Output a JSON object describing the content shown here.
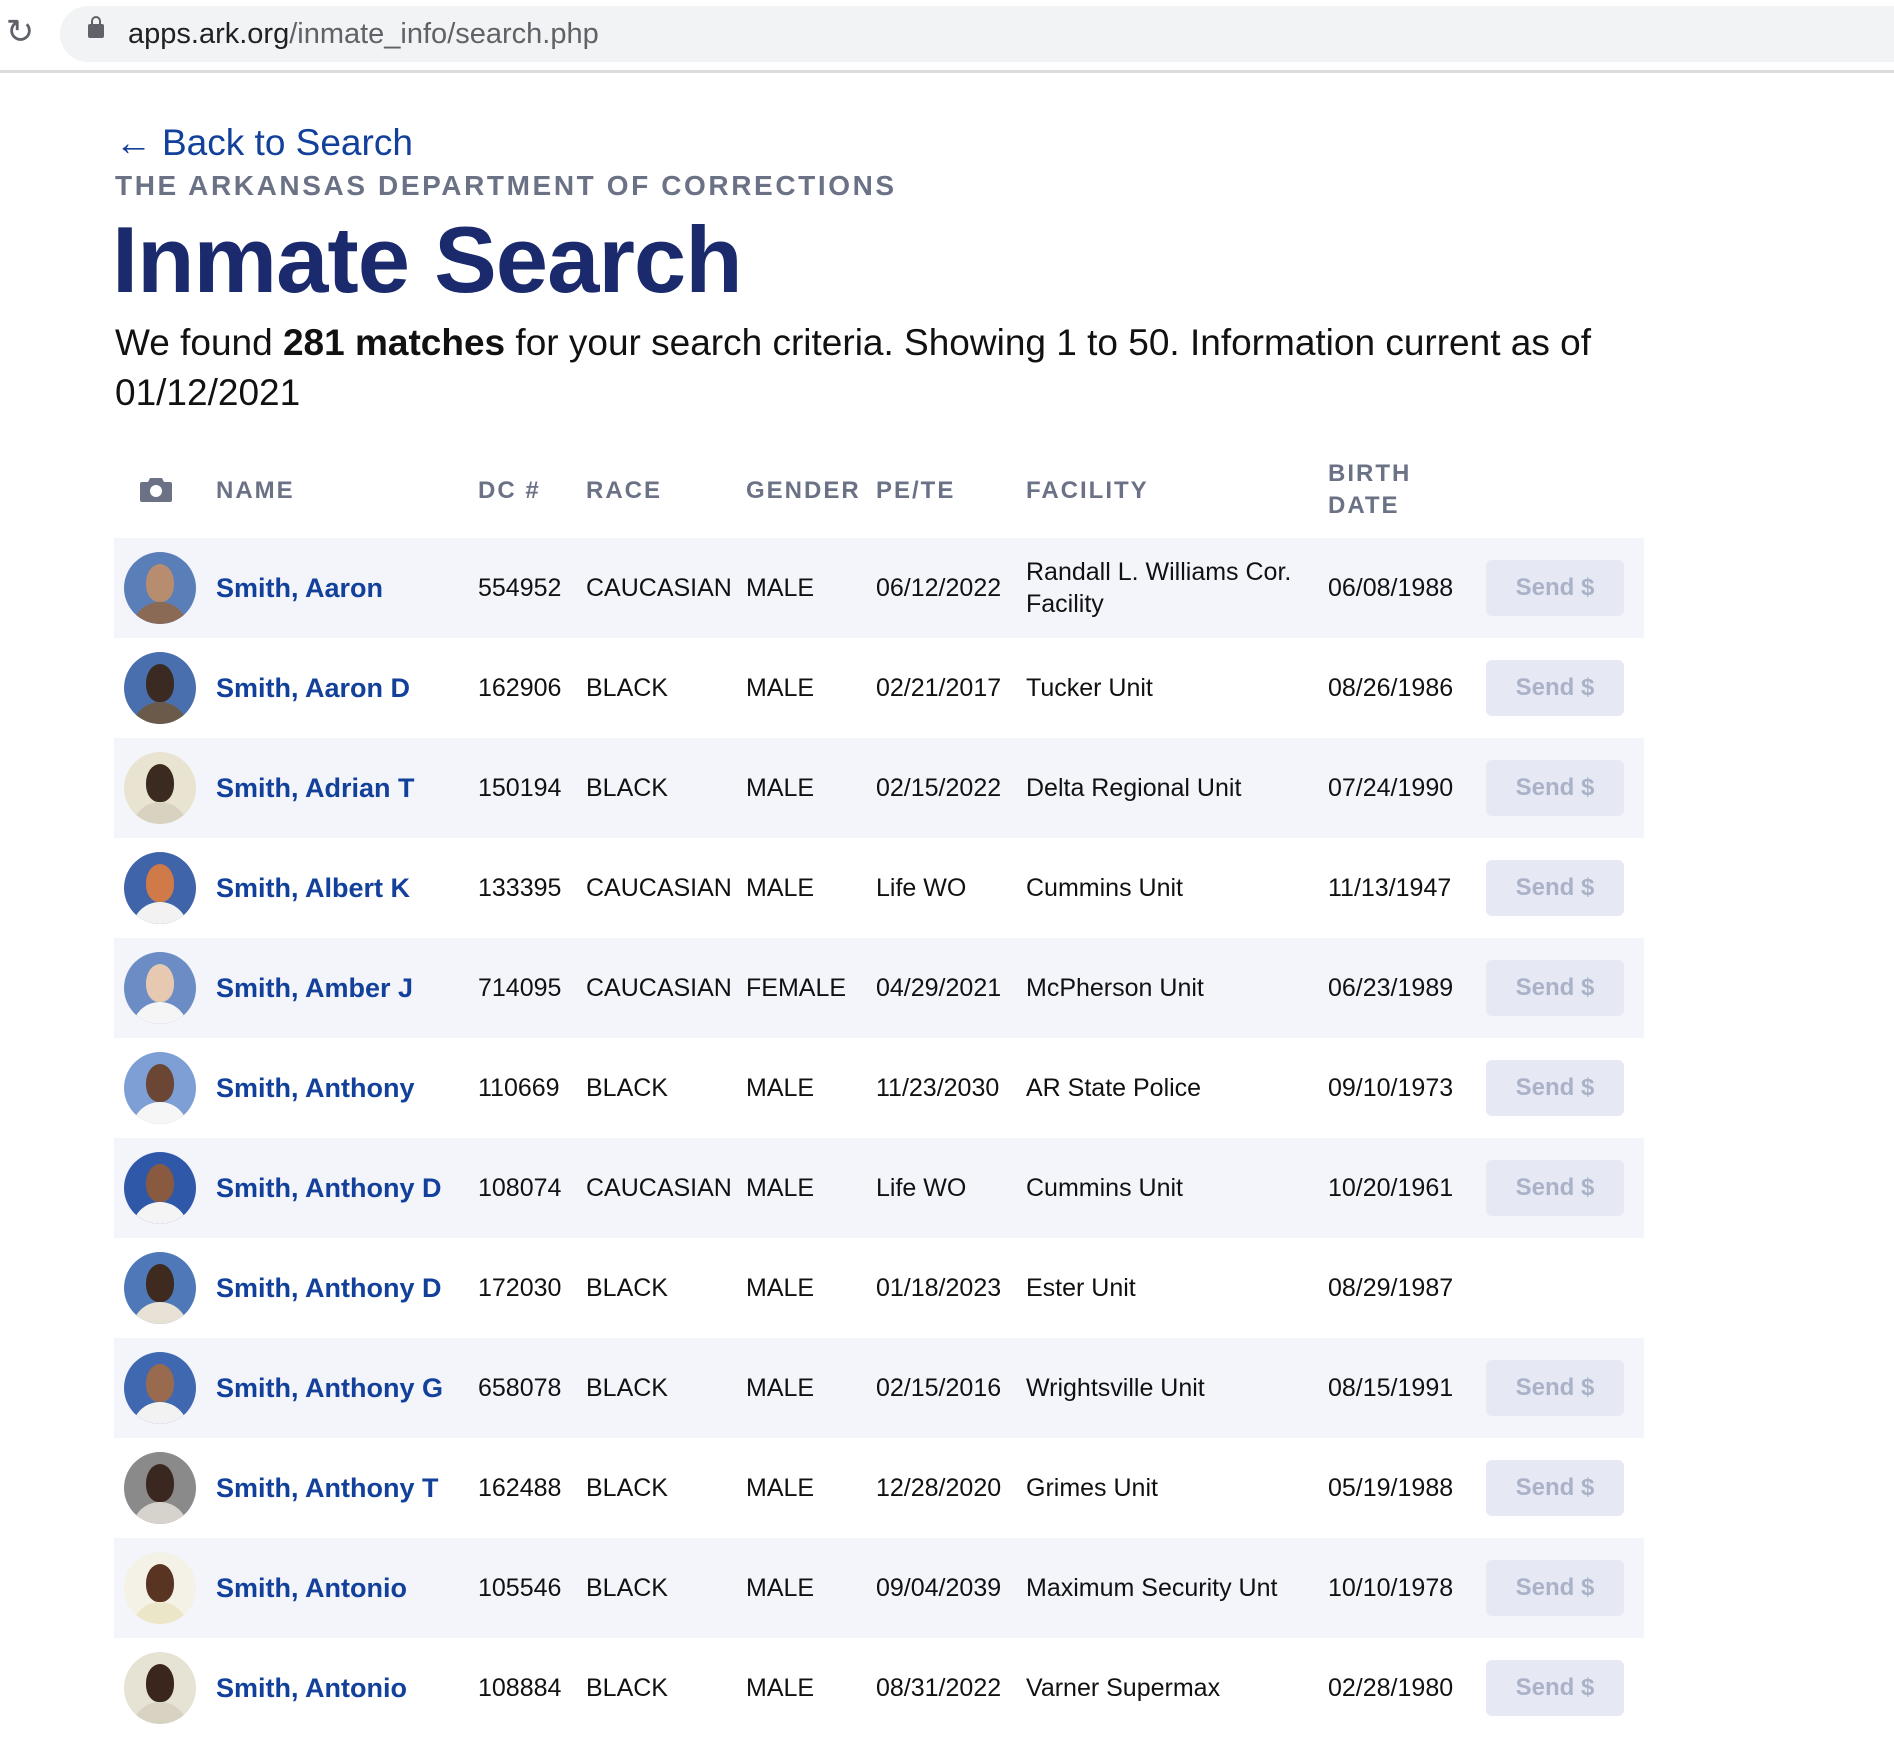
{
  "browser": {
    "url_host": "apps.ark.org",
    "url_path": "/inmate_info/search.php",
    "reload_icon": "reload-icon",
    "lock_icon": "lock-icon"
  },
  "page": {
    "back_link": "Back to Search",
    "back_arrow": "←",
    "eyebrow": "THE ARKANSAS DEPARTMENT OF CORRECTIONS",
    "title": "Inmate Search",
    "summary_prefix": "We found ",
    "summary_count": "281 matches",
    "summary_suffix": " for your search criteria. Showing 1 to 50. Information current as of 01/12/2021"
  },
  "colors": {
    "brand_navy": "#1a2a6c",
    "link_blue": "#12409a",
    "muted_gray": "#6b7286",
    "row_stripe": "#f3f5fb",
    "send_bg": "#e6e9f4",
    "send_text": "#aab2c8"
  },
  "table": {
    "headers": {
      "photo_icon": "camera-icon",
      "name": "NAME",
      "dc": "DC #",
      "race": "RACE",
      "gender": "GENDER",
      "pete": "PE/TE",
      "facility": "FACILITY",
      "birth_line1": "BIRTH",
      "birth_line2": "DATE"
    },
    "send_label": "Send $",
    "rows": [
      {
        "name": "Smith, Aaron",
        "dc": "554952",
        "race": "CAUCASIAN",
        "gender": "MALE",
        "pete": "06/12/2022",
        "facility": "Randall L. Williams Cor. Facility",
        "birth": "06/08/1988",
        "send": true,
        "skin": "#b88c6e",
        "bg": "#5a7fb8",
        "shirt": "#8a6a55"
      },
      {
        "name": "Smith, Aaron D",
        "dc": "162906",
        "race": "BLACK",
        "gender": "MALE",
        "pete": "02/21/2017",
        "facility": "Tucker Unit",
        "birth": "08/26/1986",
        "send": true,
        "skin": "#3a2a22",
        "bg": "#4a6fae",
        "shirt": "#6b5a4a"
      },
      {
        "name": "Smith, Adrian T",
        "dc": "150194",
        "race": "BLACK",
        "gender": "MALE",
        "pete": "02/15/2022",
        "facility": "Delta Regional Unit",
        "birth": "07/24/1990",
        "send": true,
        "skin": "#3b2a20",
        "bg": "#e9e4d2",
        "shirt": "#d8d2c0"
      },
      {
        "name": "Smith, Albert K",
        "dc": "133395",
        "race": "CAUCASIAN",
        "gender": "MALE",
        "pete": "Life WO",
        "facility": "Cummins Unit",
        "birth": "11/13/1947",
        "send": true,
        "skin": "#d07a4a",
        "bg": "#3f64a8",
        "shirt": "#f2f2f2"
      },
      {
        "name": "Smith, Amber J",
        "dc": "714095",
        "race": "CAUCASIAN",
        "gender": "FEMALE",
        "pete": "04/29/2021",
        "facility": "McPherson Unit",
        "birth": "06/23/1989",
        "send": true,
        "skin": "#e6c9b0",
        "bg": "#6b8cc4",
        "shirt": "#f5f5f5"
      },
      {
        "name": "Smith, Anthony",
        "dc": "110669",
        "race": "BLACK",
        "gender": "MALE",
        "pete": "11/23/2030",
        "facility": "AR State Police",
        "birth": "09/10/1973",
        "send": true,
        "skin": "#6b4634",
        "bg": "#7d9fd6",
        "shirt": "#f6f6f6"
      },
      {
        "name": "Smith, Anthony D",
        "dc": "108074",
        "race": "CAUCASIAN",
        "gender": "MALE",
        "pete": "Life WO",
        "facility": "Cummins Unit",
        "birth": "10/20/1961",
        "send": true,
        "skin": "#8a5a40",
        "bg": "#2f58a8",
        "shirt": "#f4f4f4"
      },
      {
        "name": "Smith, Anthony D",
        "dc": "172030",
        "race": "BLACK",
        "gender": "MALE",
        "pete": "01/18/2023",
        "facility": "Ester Unit",
        "birth": "08/29/1987",
        "send": false,
        "skin": "#3e2a1f",
        "bg": "#4f78b8",
        "shirt": "#e8e2d6"
      },
      {
        "name": "Smith, Anthony G",
        "dc": "658078",
        "race": "BLACK",
        "gender": "MALE",
        "pete": "02/15/2016",
        "facility": "Wrightsville Unit",
        "birth": "08/15/1991",
        "send": true,
        "skin": "#9a6a4e",
        "bg": "#3f68b0",
        "shirt": "#f2f2f2"
      },
      {
        "name": "Smith, Anthony T",
        "dc": "162488",
        "race": "BLACK",
        "gender": "MALE",
        "pete": "12/28/2020",
        "facility": "Grimes Unit",
        "birth": "05/19/1988",
        "send": true,
        "skin": "#3a2820",
        "bg": "#8a8a8a",
        "shirt": "#d6d2cc"
      },
      {
        "name": "Smith, Antonio",
        "dc": "105546",
        "race": "BLACK",
        "gender": "MALE",
        "pete": "09/04/2039",
        "facility": "Maximum Security Unt",
        "birth": "10/10/1978",
        "send": true,
        "skin": "#5a3422",
        "bg": "#f4f1e6",
        "shirt": "#ece6c8"
      },
      {
        "name": "Smith, Antonio",
        "dc": "108884",
        "race": "BLACK",
        "gender": "MALE",
        "pete": "08/31/2022",
        "facility": "Varner Supermax",
        "birth": "02/28/1980",
        "send": true,
        "skin": "#3a261c",
        "bg": "#e6e2d4",
        "shirt": "#d8d2c2"
      }
    ]
  }
}
